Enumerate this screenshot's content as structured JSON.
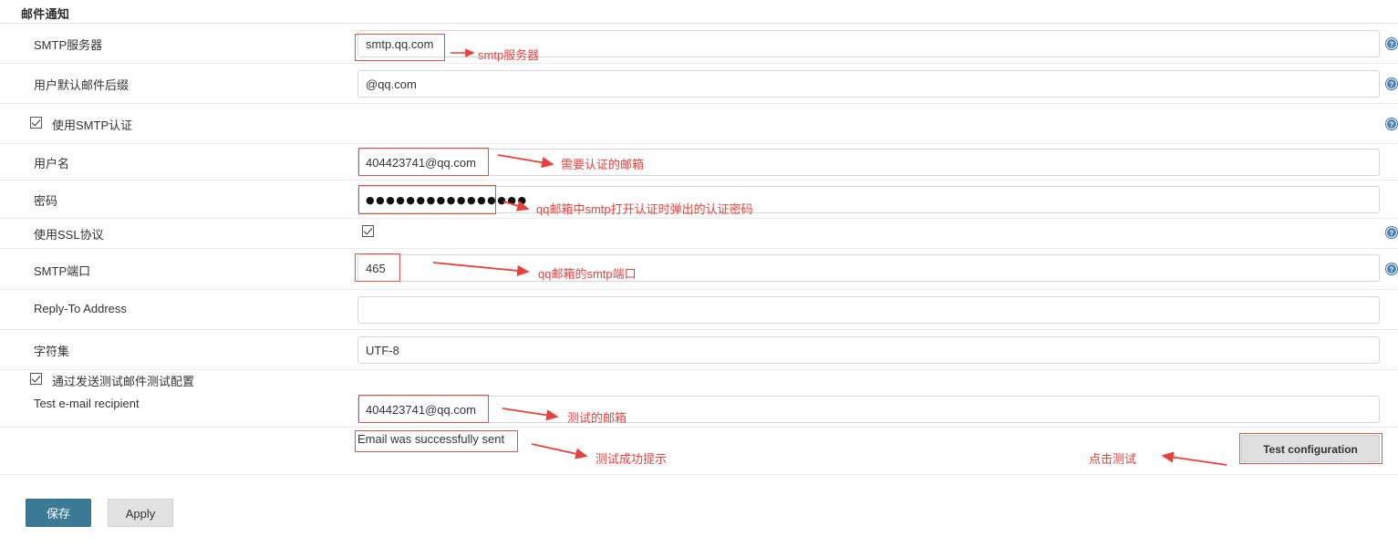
{
  "page": {
    "title": "邮件通知"
  },
  "fields": {
    "smtp_server": {
      "label": "SMTP服务器",
      "value": "smtp.qq.com",
      "placeholder": ""
    },
    "default_suffix": {
      "label": "用户默认邮件后缀",
      "value": "@qq.com",
      "placeholder": ""
    },
    "use_smtp_auth": {
      "label": "使用SMTP认证",
      "checked": true
    },
    "username": {
      "label": "用户名",
      "value": "404423741@qq.com",
      "placeholder": ""
    },
    "password": {
      "label": "密码",
      "value": "●●●●●●●●●●●●●●●●",
      "placeholder": ""
    },
    "use_ssl": {
      "label": "使用SSL协议",
      "checked": true
    },
    "smtp_port": {
      "label": "SMTP端口",
      "value": "465",
      "placeholder": ""
    },
    "reply_to": {
      "label": "Reply-To Address",
      "value": "",
      "placeholder": ""
    },
    "charset": {
      "label": "字符集",
      "value": "UTF-8",
      "placeholder": ""
    },
    "test_by_sending": {
      "label": "通过发送测试邮件测试配置",
      "checked": true
    },
    "test_recipient": {
      "label": "Test e-mail recipient",
      "value": "404423741@qq.com",
      "placeholder": ""
    }
  },
  "status": {
    "test_result": "Email was successfully sent"
  },
  "buttons": {
    "save": "保存",
    "apply": "Apply",
    "test_configuration": "Test configuration"
  },
  "icons": {
    "help": "help-icon",
    "help_count": 5
  },
  "annotations": [
    {
      "name": "smtp-server-note",
      "text": "smtp服务器"
    },
    {
      "name": "username-note",
      "text": "需要认证的邮箱"
    },
    {
      "name": "password-note",
      "text": "qq邮箱中smtp打开认证时弹出的认证密码"
    },
    {
      "name": "smtp-port-note",
      "text": "qq邮箱的smtp端口"
    },
    {
      "name": "test-recipient-note",
      "text": "测试的邮箱"
    },
    {
      "name": "test-result-note",
      "text": "测试成功提示"
    },
    {
      "name": "test-button-note",
      "text": "点击测试"
    }
  ],
  "colors": {
    "annotation_red": "#e8413c",
    "annotation_box_red": "#d9534f",
    "save_button": "#3b7a94",
    "apply_button": "#e2e2e2",
    "field_border": "#d6d6d6",
    "help_icon_blue": "#3b6ea5"
  }
}
